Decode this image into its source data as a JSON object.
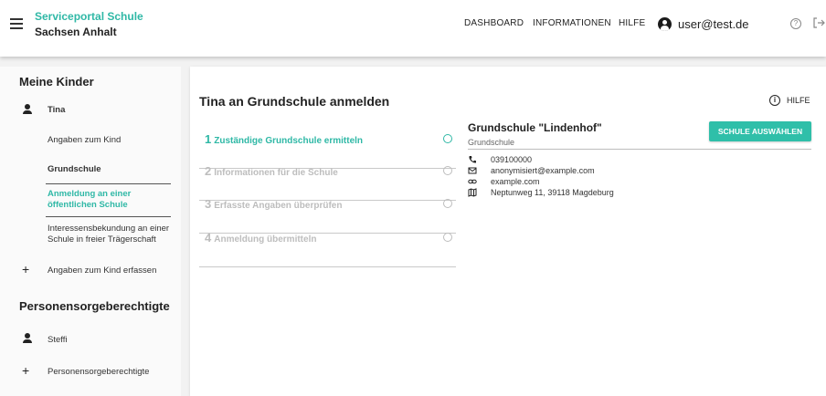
{
  "header": {
    "brand_line1": "Serviceportal Schule",
    "brand_line2": "Sachsen Anhalt",
    "nav": {
      "dashboard": "DASHBOARD",
      "informationen": "INFORMATIONEN",
      "hilfe": "HILFE"
    },
    "user_email": "user@test.de",
    "help_icon": "help-circle-icon",
    "logout_icon": "logout-icon"
  },
  "sidebar": {
    "kinder_title": "Meine Kinder",
    "child_name": "Tina",
    "child_items": [
      "Angaben zum Kind",
      "Grundschule",
      "Anmeldung an einer öffentlichen Schule",
      "Interessensbekundung an einer Schule in freier Trägerschaft"
    ],
    "add_child": "Angaben zum Kind erfassen",
    "guardians_title": "Personensorgeberechtigte",
    "guardian_name": "Steffi",
    "add_guardian": "Personensorgeberechtigte"
  },
  "main": {
    "title": "Tina an Grundschule anmelden",
    "hilfe_label": "HILFE",
    "steps": [
      {
        "num": "1",
        "label": "Zuständige Grundschule ermitteln",
        "active": true
      },
      {
        "num": "2",
        "label": "Informationen für die Schule",
        "active": false
      },
      {
        "num": "3",
        "label": "Erfasste Angaben überprüfen",
        "active": false
      },
      {
        "num": "4",
        "label": "Anmeldung übermitteln",
        "active": false
      }
    ],
    "school": {
      "name": "Grundschule \"Lindenhof\"",
      "type": "Grundschule",
      "choose_button": "SCHULE AUSWÄHLEN",
      "phone": "039100000",
      "email": "anonymisiert@example.com",
      "website": "example.com",
      "address": "Neptunweg 11, 39118 Magdeburg"
    }
  },
  "colors": {
    "accent": "#2fb8a6",
    "button": "#2fbfa9",
    "inactive": "#bdbdbd"
  }
}
